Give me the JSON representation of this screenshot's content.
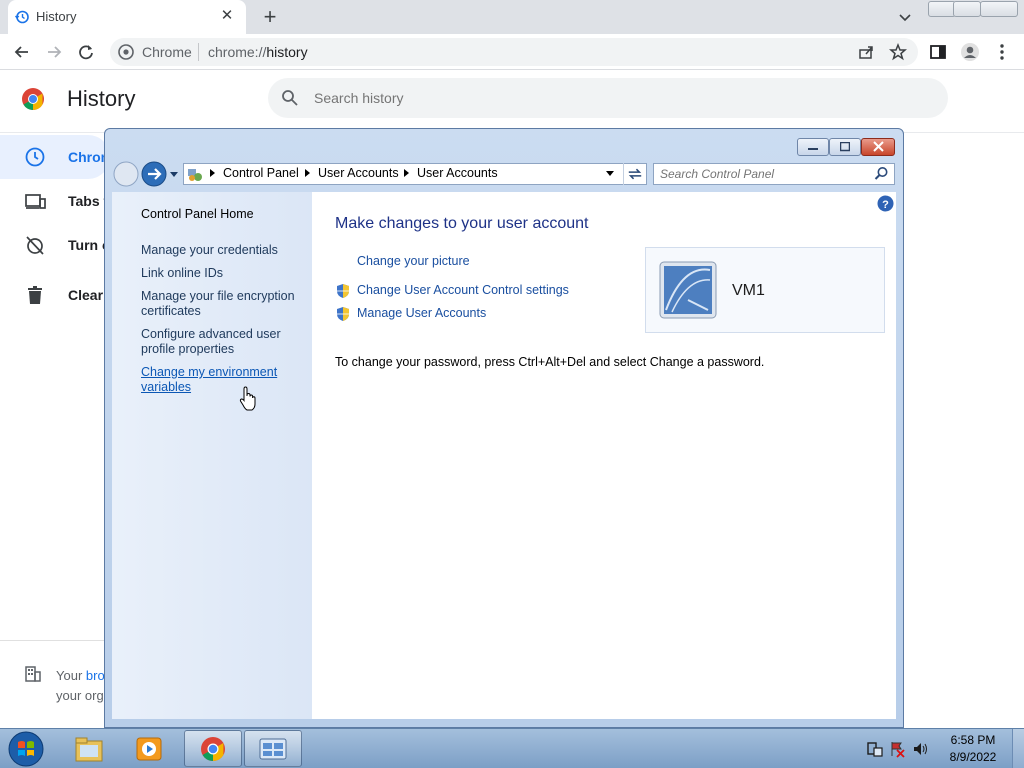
{
  "browser": {
    "tab": {
      "title": "History",
      "icon": "history-icon"
    },
    "omnibox": {
      "site_label": "Chrome",
      "url_prefix": "chrome://",
      "url_host": "history"
    },
    "toolbar_icons": [
      "back-icon",
      "forward-icon",
      "reload-icon",
      "share-icon",
      "bookmark-star-icon",
      "side-panel-icon",
      "profile-icon",
      "menu-icon"
    ]
  },
  "history_page": {
    "title": "History",
    "search": {
      "placeholder": "Search history"
    },
    "sidebar": [
      {
        "label": "Chron",
        "icon": "clock-icon"
      },
      {
        "label": "Tabs f",
        "icon": "devices-icon"
      },
      {
        "label": "Turn o",
        "icon": "history-off-icon"
      },
      {
        "label": "Clear",
        "icon": "trash-icon"
      }
    ],
    "managed": {
      "line1_prefix": "Your ",
      "line1_link": "bro",
      "line2": "your org"
    }
  },
  "control_panel": {
    "breadcrumbs": [
      "Control Panel",
      "User Accounts",
      "User Accounts"
    ],
    "search_placeholder": "Search Control Panel",
    "left_links": {
      "home": "Control Panel Home",
      "credentials": "Manage your credentials",
      "online_ids": "Link online IDs",
      "encryption": "Manage your file encryption certificates",
      "profile": "Configure advanced user profile properties",
      "environment": "Change my environment variables"
    },
    "heading": "Make changes to your user account",
    "tasks": {
      "picture": "Change your picture",
      "uac": "Change User Account Control settings",
      "manage": "Manage User Accounts"
    },
    "user_name": "VM1",
    "password_note": "To change your password, press Ctrl+Alt+Del and select Change a password."
  },
  "taskbar": {
    "time": "6:58 PM",
    "date": "8/9/2022",
    "buttons": [
      "windows-explorer-icon",
      "media-player-icon",
      "chrome-icon",
      "control-panel-icon"
    ]
  },
  "colors": {
    "link": "#1a4fa0",
    "accent": "#1a73e8",
    "taskbar": "#8fadd0"
  }
}
